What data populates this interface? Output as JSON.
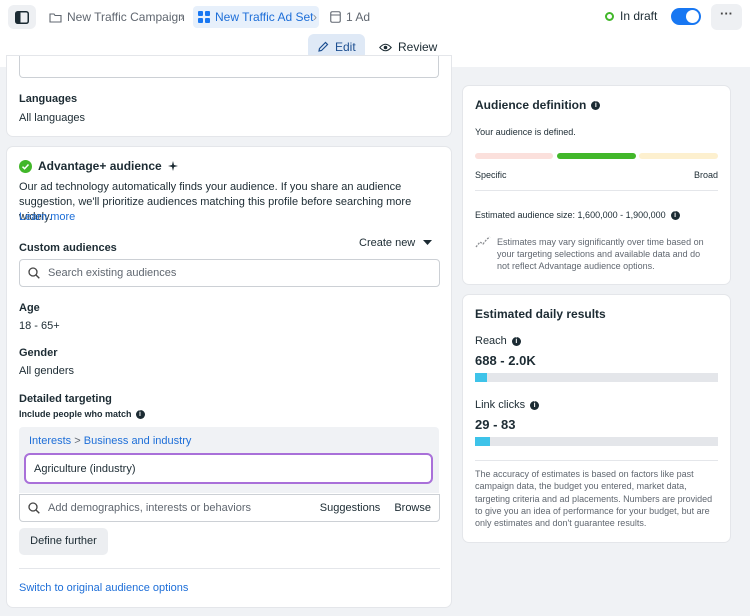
{
  "breadcrumbs": {
    "campaign": "New Traffic Campaign",
    "adset": "New Traffic Ad Set",
    "ad": "1 Ad"
  },
  "status": {
    "label": "In draft",
    "toggle_on": true
  },
  "tabs": {
    "edit": "Edit",
    "review": "Review"
  },
  "languages": {
    "label": "Languages",
    "value": "All languages"
  },
  "advantage": {
    "title": "Advantage+ audience",
    "description": "Our ad technology automatically finds your audience. If you share an audience suggestion, we'll prioritize audiences matching this profile before searching more widely.",
    "learn_more": "Learn more",
    "custom_audiences_label": "Custom audiences",
    "create_new": "Create new",
    "search_placeholder": "Search existing audiences",
    "age_label": "Age",
    "age_value": "18 - 65+",
    "gender_label": "Gender",
    "gender_value": "All genders",
    "detailed_label": "Detailed targeting",
    "include_label": "Include people who match",
    "interest_path_1": "Interests",
    "interest_sep": ">",
    "interest_path_2": "Business and industry",
    "selected_interest": "Agriculture (industry)",
    "add_placeholder": "Add demographics, interests or behaviors",
    "suggestions": "Suggestions",
    "browse": "Browse",
    "define_further": "Define further",
    "switch_link": "Switch to original audience options"
  },
  "definition": {
    "title": "Audience definition",
    "status": "Your audience is defined.",
    "specific": "Specific",
    "broad": "Broad",
    "size": "Estimated audience size: 1,600,000 - 1,900,000",
    "note": "Estimates may vary significantly over time based on your targeting selections and available data and do not reflect Advantage audience options."
  },
  "estimates": {
    "title": "Estimated daily results",
    "reach_label": "Reach",
    "reach_value": "688 - 2.0K",
    "reach_level": 0.05,
    "clicks_label": "Link clicks",
    "clicks_value": "29 - 83",
    "clicks_level": 0.06,
    "note": "The accuracy of estimates is based on factors like past campaign data, the budget you entered, market data, targeting criteria and ad placements. Numbers are provided to give you an idea of performance for your budget, but are only estimates and don't guarantee results."
  },
  "colors": {
    "accent": "#1877f2",
    "link": "#1d6ed8",
    "success": "#42b72a",
    "highlight_border": "#a970d9",
    "estimate_bar": "#3ec3e9"
  },
  "icons": {
    "sidebar": "sidebar-panel-icon",
    "folder": "folder-icon",
    "adset": "grid-icon",
    "ad": "ad-icon",
    "edit": "pencil-icon",
    "review": "eye-icon",
    "check": "check-circle-icon",
    "sparkle": "sparkle-icon",
    "search": "search-icon",
    "info": "info-icon",
    "trend": "trend-icon"
  }
}
